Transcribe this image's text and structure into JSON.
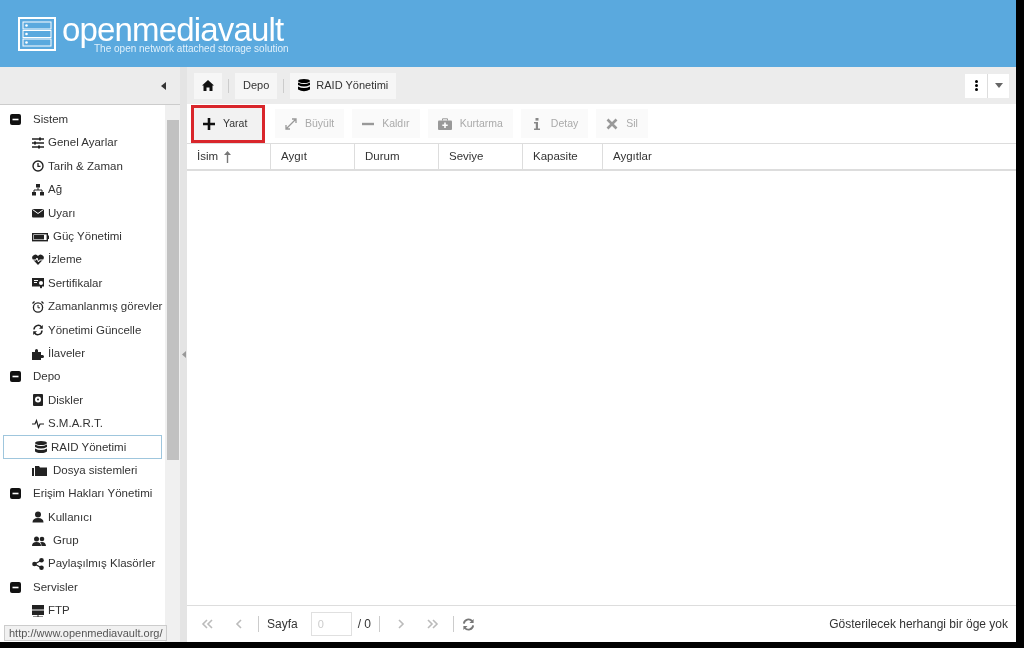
{
  "header": {
    "logo_text": "openmediavault",
    "tagline": "The open network attached storage solution"
  },
  "breadcrumb": [
    {
      "kind": "home"
    },
    {
      "kind": "link",
      "label": "Depo"
    },
    {
      "kind": "link",
      "label": "RAID Yönetimi"
    }
  ],
  "sidebar": {
    "groups": [
      {
        "label": "Sistem",
        "expanded": true,
        "children": [
          {
            "label": "Genel Ayarlar",
            "selected": false
          },
          {
            "label": "Tarih & Zaman",
            "selected": false
          },
          {
            "label": "Ağ",
            "selected": false
          },
          {
            "label": "Uyarı",
            "selected": false
          },
          {
            "label": "Güç Yönetimi",
            "selected": false
          },
          {
            "label": "İzleme",
            "selected": false
          },
          {
            "label": "Sertifikalar",
            "selected": false
          },
          {
            "label": "Zamanlanmış görevler",
            "selected": false
          },
          {
            "label": "Yönetimi Güncelle",
            "selected": false
          },
          {
            "label": "İlaveler",
            "selected": false
          }
        ]
      },
      {
        "label": "Depo",
        "expanded": true,
        "children": [
          {
            "label": "Diskler",
            "selected": false
          },
          {
            "label": "S.M.A.R.T.",
            "selected": false
          },
          {
            "label": "RAID Yönetimi",
            "selected": true
          },
          {
            "label": "Dosya sistemleri",
            "selected": false
          }
        ]
      },
      {
        "label": "Erişim Hakları Yönetimi",
        "expanded": true,
        "children": [
          {
            "label": "Kullanıcı",
            "selected": false
          },
          {
            "label": "Grup",
            "selected": false
          },
          {
            "label": "Paylaşılmış Klasörler",
            "selected": false
          }
        ]
      },
      {
        "label": "Servisler",
        "expanded": true,
        "children": [
          {
            "label": "FTP",
            "selected": false
          }
        ]
      }
    ]
  },
  "toolbar": [
    {
      "label": "Yarat",
      "disabled": false,
      "highlighted": true
    },
    {
      "label": "Büyült",
      "disabled": true,
      "highlighted": false
    },
    {
      "label": "Kaldır",
      "disabled": true,
      "highlighted": false
    },
    {
      "label": "Kurtarma",
      "disabled": true,
      "highlighted": false
    },
    {
      "label": "Detay",
      "disabled": true,
      "highlighted": false
    },
    {
      "label": "Sil",
      "disabled": true,
      "highlighted": false
    }
  ],
  "table": {
    "columns": [
      {
        "label": "İsim",
        "sorted": true
      },
      {
        "label": "Aygıt",
        "sorted": false
      },
      {
        "label": "Durum",
        "sorted": false
      },
      {
        "label": "Seviye",
        "sorted": false
      },
      {
        "label": "Kapasite",
        "sorted": false
      },
      {
        "label": "Aygıtlar",
        "sorted": false
      }
    ]
  },
  "pager": {
    "page_label": "Sayfa",
    "page_value": "0",
    "total": "/ 0",
    "empty_message": "Gösterilecek herhangi bir öge yok"
  },
  "status_url": "http://www.openmediavault.org/"
}
